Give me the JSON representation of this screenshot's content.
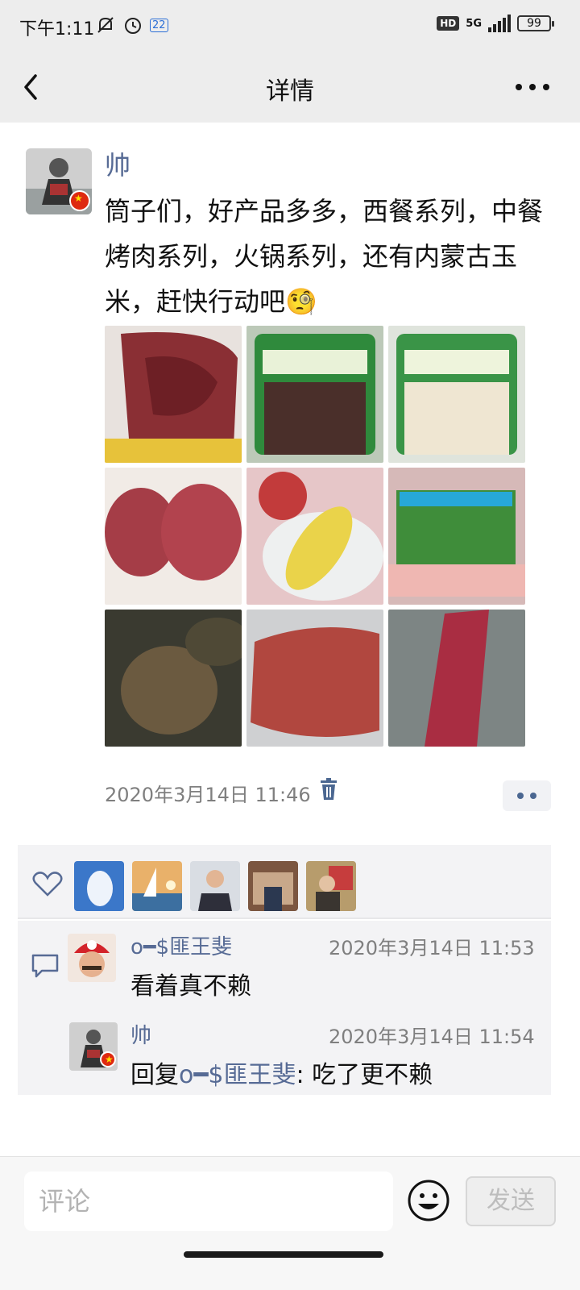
{
  "status_bar": {
    "time": "下午1:11",
    "network": "5G",
    "hd": "HD",
    "battery": "99",
    "date_badge": "22"
  },
  "header": {
    "title": "详情",
    "back_icon": "chevron-left-icon",
    "more_icon": "more-horizontal-icon"
  },
  "post": {
    "author": "帅",
    "text": "筒子们，好产品多多，西餐系列，中餐烤肉系列，火锅系列，还有内蒙古玉米，赶快行动吧🧐",
    "images": [
      {
        "alt": "raw-beef-steak"
      },
      {
        "alt": "packaged-tripe"
      },
      {
        "alt": "packaged-tripe-strips"
      },
      {
        "alt": "beef-fillets"
      },
      {
        "alt": "apple-and-corn"
      },
      {
        "alt": "fatty-beef-rolls"
      },
      {
        "alt": "grilled-beef"
      },
      {
        "alt": "peppered-steak"
      },
      {
        "alt": "marbled-beef"
      }
    ],
    "timestamp": "2020年3月14日 11:46"
  },
  "likes": {
    "users": [
      "like-user-1",
      "like-user-2",
      "like-user-3",
      "like-user-4",
      "like-user-5"
    ]
  },
  "comments": [
    {
      "author": "o━$匪王斐",
      "time": "2020年3月14日 11:53",
      "text": "看着真不赖"
    },
    {
      "author": "帅",
      "time": "2020年3月14日 11:54",
      "reply_prefix": "回复",
      "reply_to": "o━$匪王斐",
      "text": ": 吃了更不赖"
    }
  ],
  "input_bar": {
    "placeholder": "评论",
    "send_label": "发送"
  },
  "colors": {
    "name_blue": "#576b95",
    "header_bg": "#ededed",
    "panel_bg": "#f3f3f5"
  }
}
